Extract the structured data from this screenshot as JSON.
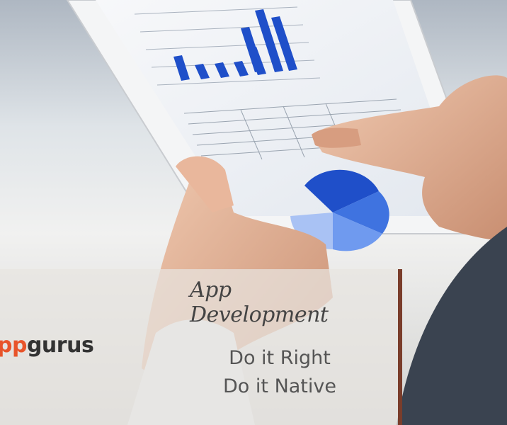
{
  "banner": {
    "headline": "App Development",
    "logo_prefix": "pp",
    "logo_suffix": "gurus",
    "tagline_line1": "Do it Right",
    "tagline_line2": "Do it Native"
  },
  "colors": {
    "accent": "#7a3d2b",
    "logo_orange": "#e8542a",
    "chart_blue": "#1f4fc9"
  },
  "icons": {
    "tablet": "tablet-illustration",
    "pie_chart": "pie-chart-illustration"
  }
}
